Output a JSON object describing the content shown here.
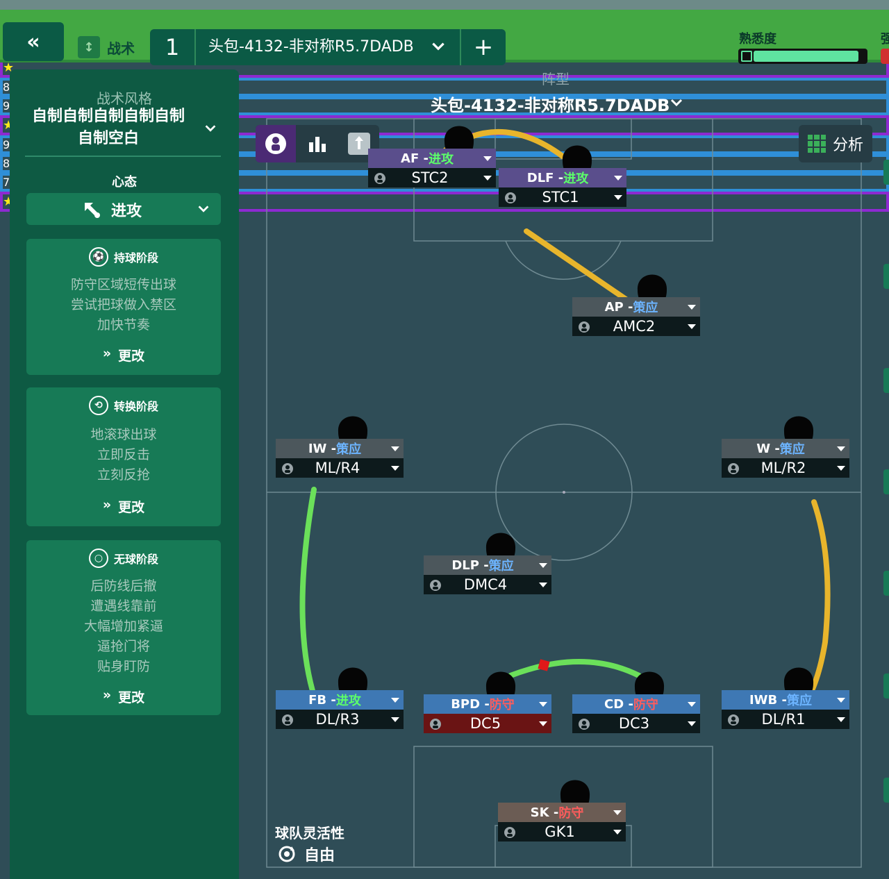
{
  "header": {
    "tactic_tab": "战术",
    "slot_number": "1",
    "slot_name": "头包-4132-非对称R5.7DADB",
    "familiarity_label": "熟悉度",
    "familiarity_level": 0.85,
    "strength_label": "强"
  },
  "sidebar": {
    "style_label": "战术风格",
    "style_value": "自制自制自制自制自制自制空白",
    "mentality_label": "心态",
    "mentality_value": "进攻",
    "phases": [
      {
        "title": "持球阶段",
        "items": [
          "防守区域短传出球",
          "尝试把球做入禁区",
          "加快节奏"
        ],
        "change": "更改"
      },
      {
        "title": "转换阶段",
        "items": [
          "地滚球出球",
          "立即反击",
          "立刻反抢"
        ],
        "change": "更改"
      },
      {
        "title": "无球阶段",
        "items": [
          "后防线后撤",
          "遭遇线靠前",
          "大幅增加紧逼",
          "逼抢门将",
          "贴身盯防"
        ],
        "change": "更改"
      }
    ]
  },
  "pitch": {
    "formation_label": "阵型",
    "formation_name": "头包-4132-非对称R5.7DADB",
    "analysis_label": "分析",
    "flex_label": "球队灵活性",
    "flex_value": "自由"
  },
  "players": [
    {
      "role": "AF - ",
      "duty": "进攻",
      "duty_type": "attack",
      "pos": "STC2",
      "badge": "9",
      "badge_type": "blue",
      "card_color": "purple"
    },
    {
      "role": "DLF - ",
      "duty": "进攻",
      "duty_type": "attack",
      "pos": "STC1",
      "badge": "8",
      "badge_type": "blue",
      "card_color": "purple"
    },
    {
      "role": "AP - ",
      "duty": "策应",
      "duty_type": "support",
      "pos": "AMC2",
      "badge": "★",
      "badge_type": "star",
      "card_color": "gray"
    },
    {
      "role": "IW - ",
      "duty": "策应",
      "duty_type": "support",
      "pos": "ML/R4",
      "badge": "★",
      "badge_type": "star",
      "card_color": "gray"
    },
    {
      "role": "W - ",
      "duty": "策应",
      "duty_type": "support",
      "pos": "ML/R2",
      "badge": "8",
      "badge_type": "blue",
      "card_color": "gray"
    },
    {
      "role": "DLP - ",
      "duty": "策应",
      "duty_type": "support",
      "pos": "DMC4",
      "badge": "9",
      "badge_type": "blue",
      "card_color": "gray"
    },
    {
      "role": "FB - ",
      "duty": "进攻",
      "duty_type": "attack",
      "pos": "DL/R3",
      "badge": "★",
      "badge_type": "star",
      "card_color": "blue"
    },
    {
      "role": "BPD - ",
      "duty": "防守",
      "duty_type": "defend",
      "pos": "DC5",
      "badge": "9",
      "badge_type": "blue",
      "card_color": "blue"
    },
    {
      "role": "CD - ",
      "duty": "防守",
      "duty_type": "defend",
      "pos": "DC3",
      "badge": "8",
      "badge_type": "blue",
      "card_color": "blue"
    },
    {
      "role": "IWB - ",
      "duty": "策应",
      "duty_type": "support",
      "pos": "DL/R1",
      "badge": "7",
      "badge_type": "blue",
      "card_color": "blue"
    },
    {
      "role": "SK - ",
      "duty": "防守",
      "duty_type": "defend",
      "pos": "GK1",
      "badge": "★",
      "badge_type": "star",
      "card_color": "brown"
    }
  ],
  "colors": {
    "accent": "#43a843",
    "panel": "#0e5a43",
    "pitch": "#2f4d57",
    "link_yellow": "#e8b52c",
    "link_green": "#6be05a"
  }
}
